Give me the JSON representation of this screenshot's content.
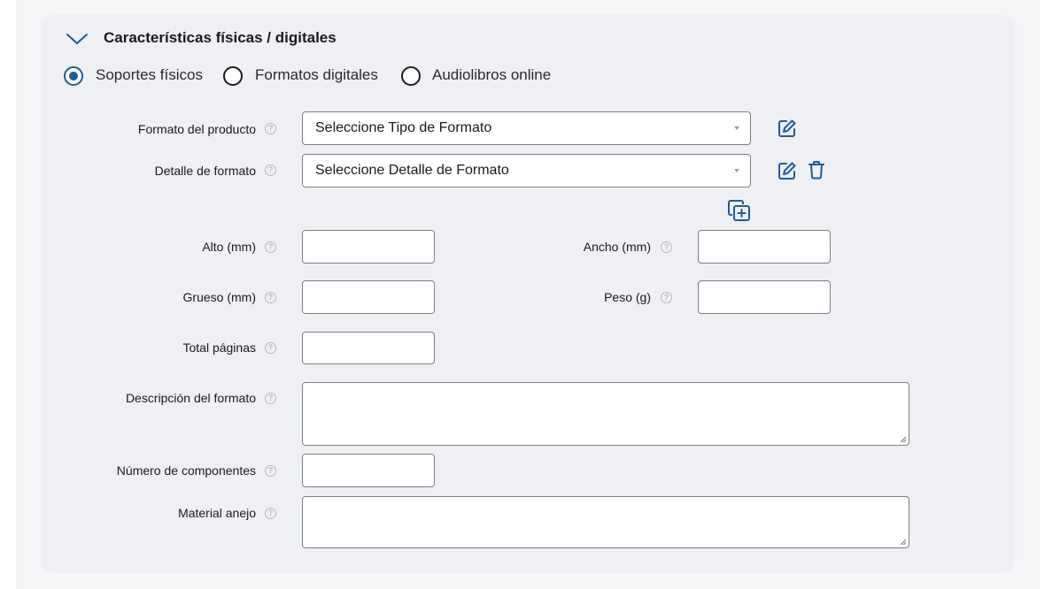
{
  "section": {
    "title": "Características físicas / digitales",
    "expanded": true
  },
  "radio_options": [
    {
      "label": "Soportes físicos",
      "checked": true
    },
    {
      "label": "Formatos digitales",
      "checked": false
    },
    {
      "label": "Audiolibros online",
      "checked": false
    }
  ],
  "fields": {
    "formato_producto": {
      "label": "Formato del producto",
      "value": "Seleccione Tipo de Formato"
    },
    "detalle_formato": {
      "label": "Detalle de formato",
      "value": "Seleccione Detalle de Formato"
    },
    "alto": {
      "label": "Alto (mm)",
      "value": ""
    },
    "ancho": {
      "label": "Ancho (mm)",
      "value": ""
    },
    "grueso": {
      "label": "Grueso (mm)",
      "value": ""
    },
    "peso": {
      "label": "Peso (g)",
      "value": ""
    },
    "total_paginas": {
      "label": "Total páginas",
      "value": ""
    },
    "descripcion": {
      "label": "Descripción del formato",
      "value": ""
    },
    "num_componentes": {
      "label": "Número de componentes",
      "value": ""
    },
    "material_anejo": {
      "label": "Material anejo",
      "value": ""
    }
  },
  "help_glyph": "?",
  "icons": {
    "collapse": "chevron-down-icon",
    "edit": "edit-icon",
    "delete": "trash-icon",
    "duplicate": "copy-plus-icon",
    "help": "help-circle-icon"
  },
  "colors": {
    "accent": "#1d5c96",
    "card_bg": "#eef0f4",
    "border": "#7b7f86"
  }
}
